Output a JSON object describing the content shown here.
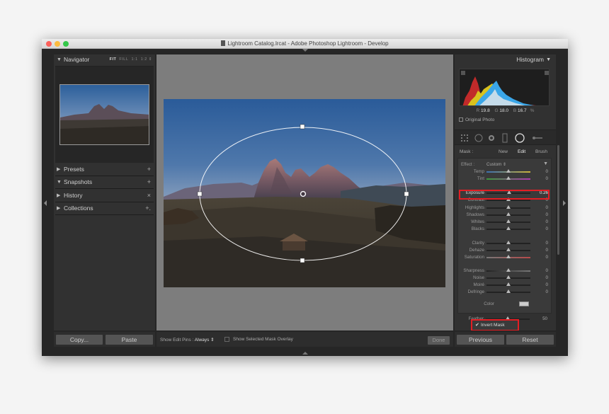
{
  "window": {
    "title": "Lightroom Catalog.lrcat - Adobe Photoshop Lightroom - Develop"
  },
  "left_panel": {
    "navigator": {
      "label": "Navigator",
      "zoom_options": [
        "FIT",
        "FILL",
        "1:1",
        "1:2 ⇕"
      ]
    },
    "sections": [
      {
        "label": "Presets",
        "action": "+",
        "expanded": false
      },
      {
        "label": "Snapshots",
        "action": "+",
        "expanded": true
      },
      {
        "label": "History",
        "action": "×",
        "expanded": false
      },
      {
        "label": "Collections",
        "action": "+.",
        "expanded": false
      }
    ],
    "copy_label": "Copy...",
    "paste_label": "Paste"
  },
  "toolbar": {
    "edit_pins_label": "Show Edit Pins :",
    "edit_pins_value": "Always ⇕",
    "mask_overlay_label": "Show Selected Mask Overlay",
    "done_label": "Done"
  },
  "right_panel": {
    "histogram": {
      "label": "Histogram",
      "r_label": "R",
      "r_value": "19.8",
      "g_label": "G",
      "g_value": "18.0",
      "b_label": "B",
      "b_value": "16.7",
      "percent": "%"
    },
    "original_photo_label": "Original Photo",
    "mask": {
      "label": "Mask :",
      "new_label": "New",
      "edit_label": "Edit",
      "brush_label": "Brush"
    },
    "effect": {
      "label": "Effect :",
      "value": "Custom ⇕"
    },
    "sliders": [
      {
        "label": "Temp",
        "value": "0",
        "position": 0.5
      },
      {
        "label": "Tint",
        "value": "0",
        "position": 0.5
      },
      {
        "label": "Exposure",
        "value": "0.26",
        "position": 0.52
      },
      {
        "label": "Contrast",
        "value": "0",
        "position": 0.5
      },
      {
        "label": "Highlights",
        "value": "0",
        "position": 0.5
      },
      {
        "label": "Shadows",
        "value": "0",
        "position": 0.5
      },
      {
        "label": "Whites",
        "value": "0",
        "position": 0.5
      },
      {
        "label": "Blacks",
        "value": "0",
        "position": 0.5
      },
      {
        "label": "Clarity",
        "value": "0",
        "position": 0.5
      },
      {
        "label": "Dehaze",
        "value": "0",
        "position": 0.5
      },
      {
        "label": "Saturation",
        "value": "0",
        "position": 0.5
      },
      {
        "label": "Sharpness",
        "value": "0",
        "position": 0.5
      },
      {
        "label": "Noise",
        "value": "0",
        "position": 0.5
      },
      {
        "label": "Moiré",
        "value": "0",
        "position": 0.5
      },
      {
        "label": "Defringe",
        "value": "0",
        "position": 0.5
      }
    ],
    "color_label": "Color",
    "feather": {
      "label": "Feather",
      "value": "50",
      "position": 0.5
    },
    "invert_mask_label": "Invert Mask",
    "invert_checked": "✔",
    "previous_label": "Previous",
    "reset_label": "Reset"
  },
  "colors": {
    "highlight_box": "#e31e24",
    "panel_bg": "#313131",
    "canvas_bg": "#7d7d7d"
  }
}
